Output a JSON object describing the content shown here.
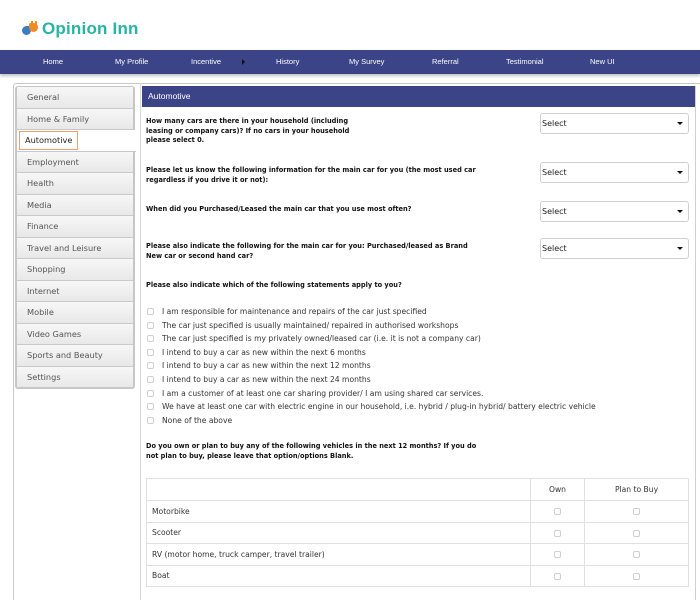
{
  "brand": {
    "name": "Opinion Inn",
    "icon": "puzzle-logo-icon",
    "color": "#26b5a4"
  },
  "nav": {
    "color": "#3a4487",
    "items": [
      {
        "label": "Home"
      },
      {
        "label": "My Profile"
      },
      {
        "label": "Incentive",
        "has_submenu": true
      },
      {
        "label": "History"
      },
      {
        "label": "My Survey"
      },
      {
        "label": "Referral"
      },
      {
        "label": "Testimonial"
      },
      {
        "label": "New UI"
      }
    ]
  },
  "sidebar": {
    "active": "Automotive",
    "items": [
      {
        "label": "General"
      },
      {
        "label": "Home & Family"
      },
      {
        "label": "Automotive"
      },
      {
        "label": "Employment"
      },
      {
        "label": "Health"
      },
      {
        "label": "Media"
      },
      {
        "label": "Finance"
      },
      {
        "label": "Travel and Leisure"
      },
      {
        "label": "Shopping"
      },
      {
        "label": "Internet"
      },
      {
        "label": "Mobile"
      },
      {
        "label": "Video Games"
      },
      {
        "label": "Sports and Beauty"
      },
      {
        "label": "Settings"
      }
    ]
  },
  "panel": {
    "title": "Automotive",
    "questions": [
      {
        "text": "How many cars are there in your household (including leasing or company cars)? If no cars in your household please select 0.",
        "lines": [
          "How many cars are there in your household (including",
          "leasing or company cars)? If no cars in your household",
          "please select 0."
        ],
        "select_value": "Select"
      },
      {
        "text": "Please let us know the following information for the main car for you (the most used car regardless if you drive it or not):",
        "lines": [
          "Please let us know the following information for the main car for you (the most used car",
          "regardless if you drive it or not):"
        ],
        "select_value": "Select"
      },
      {
        "text": "When did you Purchased/Leased the main car that you use most often?",
        "lines": [
          "When did you Purchased/Leased the main car that you use most often?"
        ],
        "select_value": "Select"
      },
      {
        "text": "Please also indicate the following for the main car for you: Purchased/leased as Brand New car or second hand car?",
        "lines": [
          "Please also indicate the following for the main car for you: Purchased/leased as Brand",
          "New car or second hand car?"
        ],
        "select_value": "Select"
      }
    ],
    "statements": {
      "question": "Please also indicate which of the following statements apply to you?",
      "options": [
        {
          "label": "I am responsible for maintenance and repairs of the car just specified",
          "checked": false
        },
        {
          "label": "The car just specified is usually maintained/ repaired in authorised workshops",
          "checked": false
        },
        {
          "label": "The car just specified is my privately owned/leased car (i.e. it is not a company car)",
          "checked": false
        },
        {
          "label": "I intend to buy a car as new within the next 6 months",
          "checked": false
        },
        {
          "label": "I intend to buy a car as new within the next 12 months",
          "checked": false
        },
        {
          "label": "I intend to buy a car as new within the next 24 months",
          "checked": false
        },
        {
          "label": "I am a customer of at least one car sharing provider/ I am using shared car services.",
          "checked": false
        },
        {
          "label": "We have at least one car with electric engine in our household, i.e. hybrid / plug-in hybrid/ battery electric vehicle",
          "checked": false
        },
        {
          "label": "None of the above",
          "checked": false
        }
      ]
    },
    "vehicles": {
      "question_lines": [
        "Do you own or plan to buy any of the following vehicles in the next 12 months? If you do",
        "not plan to buy, please leave that option/options Blank."
      ],
      "columns": [
        "",
        "Own",
        "Plan to Buy"
      ],
      "rows": [
        {
          "label": "Motorbike",
          "own": false,
          "plan": false
        },
        {
          "label": "Scooter",
          "own": false,
          "plan": false
        },
        {
          "label": "RV (motor home, truck camper, travel trailer)",
          "own": false,
          "plan": false
        },
        {
          "label": "Boat",
          "own": false,
          "plan": false
        }
      ]
    }
  }
}
